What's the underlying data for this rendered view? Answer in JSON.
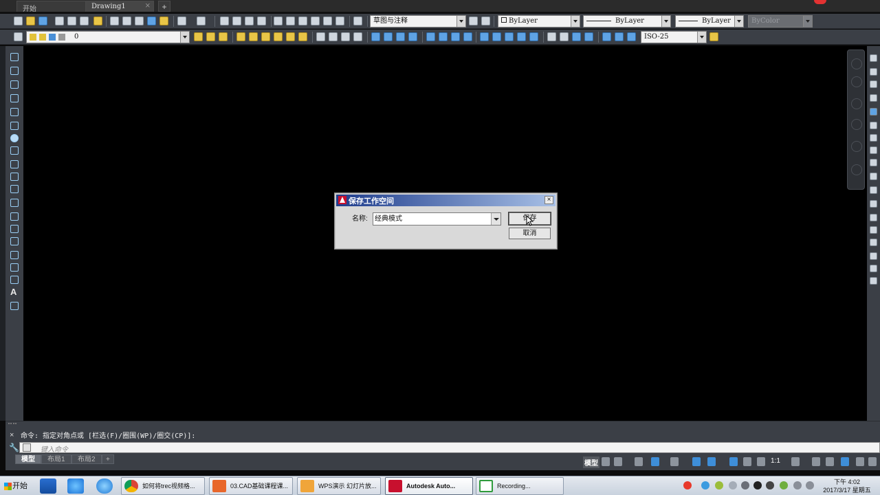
{
  "tabs": [
    {
      "label": "开始"
    },
    {
      "label": "Drawing1",
      "close": "×"
    }
  ],
  "tab_add": "+",
  "toolbar1": {
    "workspace": "草图与注释",
    "layer_color": "ByLayer",
    "linetype": "ByLayer",
    "lineweight": "ByLayer",
    "plot_style": "ByColor"
  },
  "toolbar2": {
    "layer": "0",
    "dim_style": "ISO-25"
  },
  "dialog": {
    "title": "保存工作空间",
    "close": "×",
    "name_label": "名称:",
    "name_value": "经典模式",
    "save_label": "保存",
    "cancel_label": "取消"
  },
  "command": {
    "close": "×",
    "history": "命令: 指定对角点或 [栏选(F)/圈围(WP)/圈交(CP)]:",
    "placeholder": "键入命令"
  },
  "layout_tabs": [
    {
      "label": "模型",
      "active": true
    },
    {
      "label": "布局1",
      "active": false
    },
    {
      "label": "布局2",
      "active": false
    }
  ],
  "layout_add": "+",
  "status": {
    "model": "模型",
    "scale": "1:1"
  },
  "taskbar": {
    "start": "开始",
    "apps": [
      {
        "label": "如何将trec视频格...",
        "icon": "chrome-icon"
      },
      {
        "label": "03.CAD基础课程课...",
        "icon": "wps-presentation-icon"
      },
      {
        "label": "WPS演示 幻灯片放...",
        "icon": "wps-slides-icon"
      },
      {
        "label": "Autodesk Auto...",
        "icon": "autocad-icon"
      },
      {
        "label": "Recording...",
        "icon": "camtasia-icon"
      }
    ],
    "clock_time": "下午 4:02",
    "clock_date": "2017/3/17 星期五"
  },
  "colors": {
    "canvas": "#000000",
    "ui_dark": "#3b3f46",
    "dialog_title": "#1e3c8c",
    "autocad_red": "#c8102e"
  }
}
